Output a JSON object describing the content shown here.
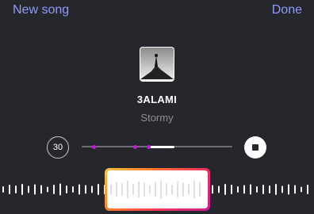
{
  "header": {
    "new_song_label": "New song",
    "done_label": "Done"
  },
  "track": {
    "artist": "3ALAMI",
    "title": "Stormy"
  },
  "controls": {
    "duration_label": "30"
  },
  "colors": {
    "background": "#26272c",
    "accent": "#8e9bff",
    "marker": "#c319d8"
  }
}
